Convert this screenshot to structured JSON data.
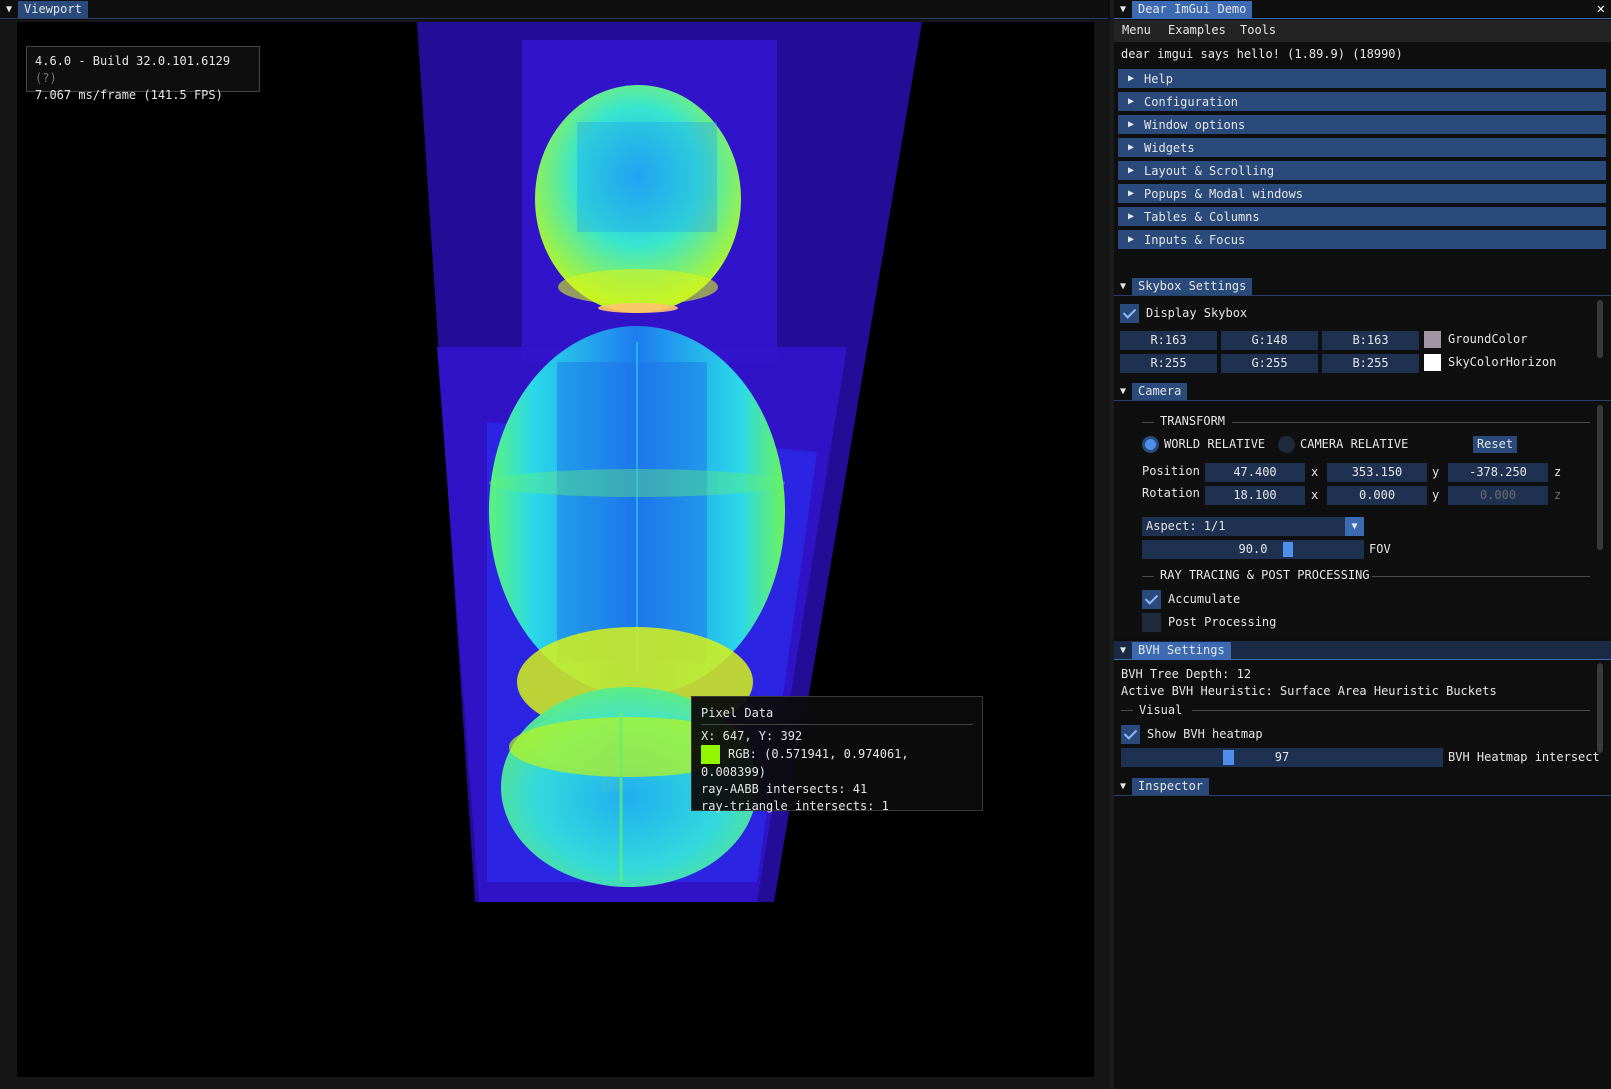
{
  "viewport": {
    "title": "Viewport",
    "overlay": {
      "version": "4.6.0 - Build 32.0.101.6129",
      "help_marker": "(?)",
      "frame_time": "7.067 ms/frame (141.5 FPS)"
    },
    "pixel_tooltip": {
      "title": "Pixel Data",
      "coords": "X: 647, Y: 392",
      "rgb": "RGB: (0.571941, 0.974061, 0.008399)",
      "swatch_color": "#92f802",
      "aabb": "ray-AABB intersects: 41",
      "triangle": "ray-triangle intersects: 1"
    }
  },
  "demo": {
    "title": "Dear ImGui Demo",
    "close_icon": "close-icon",
    "menu": [
      "Menu",
      "Examples",
      "Tools"
    ],
    "hello": "dear imgui says hello! (1.89.9) (18990)",
    "sections": [
      "Help",
      "Configuration",
      "Window options",
      "Widgets",
      "Layout & Scrolling",
      "Popups & Modal windows",
      "Tables & Columns",
      "Inputs & Focus"
    ]
  },
  "skybox": {
    "title": "Skybox Settings",
    "display_label": "Display Skybox",
    "display_checked": true,
    "ground": {
      "r": "R:163",
      "g": "G:148",
      "b": "B:163",
      "label": "GroundColor",
      "color": "#a394a3"
    },
    "sky": {
      "r": "R:255",
      "g": "G:255",
      "b": "B:255",
      "label": "SkyColorHorizon",
      "color": "#ffffff"
    }
  },
  "camera": {
    "title": "Camera",
    "transform_label": "TRANSFORM",
    "world_relative": "WORLD RELATIVE",
    "camera_relative": "CAMERA RELATIVE",
    "reset": "Reset",
    "position_label": "Position",
    "position": {
      "x": "47.400",
      "y": "353.150",
      "z": "-378.250"
    },
    "rotation_label": "Rotation",
    "rotation": {
      "x": "18.100",
      "y": "0.000",
      "z": "0.000"
    },
    "axis": {
      "x": "x",
      "y": "y",
      "z": "z"
    },
    "aspect": "Aspect: 1/1",
    "fov_value": "90.0",
    "fov_label": "FOV",
    "ray_label": "RAY TRACING & POST PROCESSING",
    "accumulate": "Accumulate",
    "accumulate_checked": true,
    "post_processing": "Post Processing",
    "post_checked": false
  },
  "bvh": {
    "title": "BVH Settings",
    "depth": "BVH Tree Depth: 12",
    "heuristic": "Active BVH Heuristic: Surface Area Heuristic Buckets",
    "visual_label": "Visual",
    "show_heatmap": "Show BVH heatmap",
    "heatmap_checked": true,
    "slider_value": "97",
    "slider_label": "BVH Heatmap intersect"
  },
  "inspector": {
    "title": "Inspector"
  },
  "colors": {
    "header": "#294a7a",
    "accent": "#4f8eea"
  }
}
